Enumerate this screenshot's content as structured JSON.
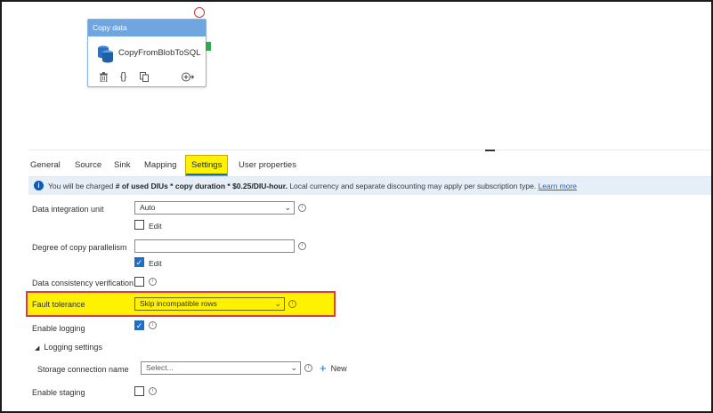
{
  "canvas": {
    "activity": {
      "header": "Copy data",
      "name": "CopyFromBlobToSQL",
      "icons": [
        "delete-icon",
        "code-icon",
        "copy-icon",
        "add-output-icon"
      ]
    }
  },
  "tabs": [
    {
      "label": "General"
    },
    {
      "label": "Source"
    },
    {
      "label": "Sink"
    },
    {
      "label": "Mapping"
    },
    {
      "label": "Settings",
      "active": true
    },
    {
      "label": "User properties"
    }
  ],
  "banner": {
    "prefix": "You will be charged ",
    "bold": "# of used DIUs * copy duration * $0.25/DIU-hour.",
    "suffix": " Local currency and separate discounting may apply per subscription type. ",
    "link": "Learn more"
  },
  "form": {
    "diu": {
      "label": "Data integration unit",
      "value": "Auto",
      "edit_label": "Edit"
    },
    "parallelism": {
      "label": "Degree of copy parallelism",
      "value": "",
      "edit_label": "Edit"
    },
    "consistency": {
      "label": "Data consistency verification"
    },
    "fault_tolerance": {
      "label": "Fault tolerance",
      "value": "Skip incompatible rows"
    },
    "logging": {
      "label": "Enable logging"
    },
    "logging_settings": {
      "label": "Logging settings"
    },
    "storage": {
      "label": "Storage connection name",
      "placeholder": "Select...",
      "new_label": "New"
    },
    "staging": {
      "label": "Enable staging"
    }
  },
  "colors": {
    "highlight": "#fff200",
    "highlight_border": "#e23b3b",
    "accent": "#1f6fc9",
    "header": "#6fa6df"
  }
}
